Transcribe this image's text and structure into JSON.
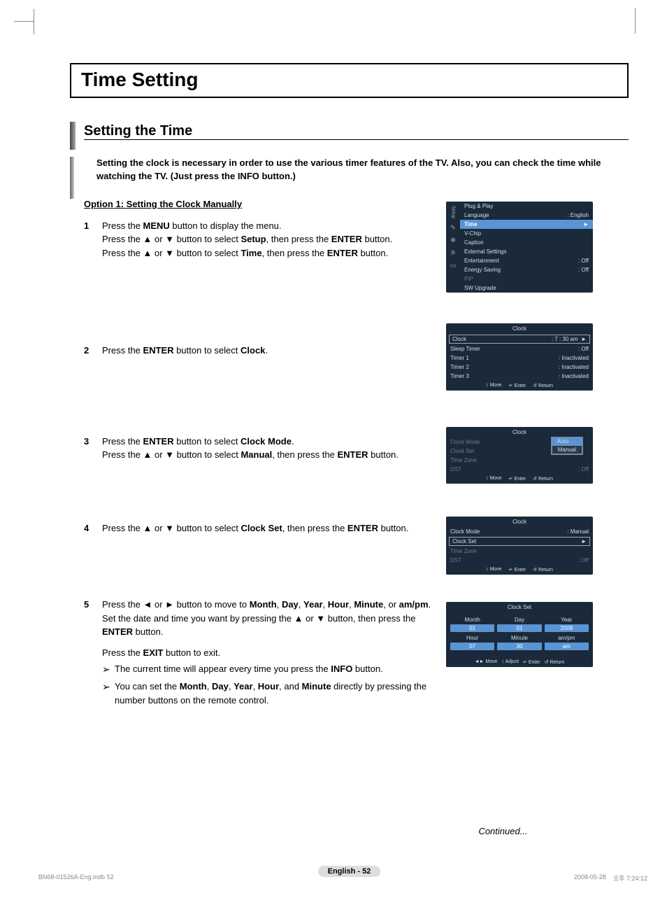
{
  "page": {
    "title": "Time Setting",
    "subheading": "Setting the Time",
    "intro": "Setting the clock is necessary in order to use the various timer features of the TV. Also, you can check the time while watching the TV. (Just press the INFO button.)",
    "option_title": "Option 1: Setting the Clock Manually",
    "continued": "Continued...",
    "page_label": "English - 52",
    "footer_left": "BN68-01526A-Eng.indb   52",
    "footer_date": "2008-05-28",
    "footer_time": "오후 7:24:12"
  },
  "steps": {
    "s1": {
      "num": "1",
      "l1a": "Press the ",
      "l1b": "MENU",
      "l1c": " button to display the menu.",
      "l2a": "Press the ▲ or ▼ button to select ",
      "l2b": "Setup",
      "l2c": ", then press the ",
      "l2d": "ENTER",
      "l2e": " button.",
      "l3a": "Press the ▲ or ▼ button to select ",
      "l3b": "Time",
      "l3c": ", then press the ",
      "l3d": "ENTER",
      "l3e": " button."
    },
    "s2": {
      "num": "2",
      "l1a": "Press the ",
      "l1b": "ENTER",
      "l1c": " button to select ",
      "l1d": "Clock",
      "l1e": "."
    },
    "s3": {
      "num": "3",
      "l1a": "Press the ",
      "l1b": "ENTER",
      "l1c": " button to select ",
      "l1d": "Clock Mode",
      "l1e": ".",
      "l2a": "Press the ▲ or ▼ button to select ",
      "l2b": "Manual",
      "l2c": ", then press the ",
      "l2d": "ENTER",
      "l2e": " button."
    },
    "s4": {
      "num": "4",
      "l1a": "Press the ▲ or ▼ button to select ",
      "l1b": "Clock Set",
      "l1c": ", then press the ",
      "l1d": "ENTER",
      "l1e": " button."
    },
    "s5": {
      "num": "5",
      "l1a": "Press the ◄ or ► button to move to ",
      "l1b": "Month",
      "l1c": ", ",
      "l1d": "Day",
      "l1e": ", ",
      "l1f": "Year",
      "l1g": ", ",
      "l1h": "Hour",
      "l1i": ", ",
      "l1j": "Minute",
      "l1k": ", or ",
      "l1l": "am/pm",
      "l1m": ". Set the date and time you want by pressing the ▲ or ▼ button, then press the ",
      "l1n": "ENTER",
      "l1o": " button.",
      "l2a": "Press the ",
      "l2b": "EXIT",
      "l2c": " button to exit.",
      "n1a": "The current time will appear every time you press the ",
      "n1b": "INFO",
      "n1c": " button.",
      "n2a": "You can set the ",
      "n2b": "Month",
      "n2c": ", ",
      "n2d": "Day",
      "n2e": ", ",
      "n2f": "Year",
      "n2g": ", ",
      "n2h": "Hour",
      "n2i": ", and ",
      "n2j": "Minute",
      "n2k": " directly by pressing the number buttons on the remote control."
    }
  },
  "osd": {
    "setup_tab": "Setup",
    "menu1": {
      "i1": "Plug & Play",
      "i2": "Language",
      "i2v": ": English",
      "i3": "Time",
      "i4": "V-Chip",
      "i5": "Caption",
      "i6": "External Settings",
      "i7": "Entertainment",
      "i7v": ": Off",
      "i8": "Energy Saving",
      "i8v": ": Off",
      "i9": "PIP",
      "i10": "SW Upgrade"
    },
    "foot": {
      "move": "Move",
      "enter": "Enter",
      "ret": "Return",
      "adjust": "Adjust"
    },
    "sym": {
      "updown": "↕",
      "enter": "↵",
      "ret": "↺",
      "lr": "◄►"
    },
    "clock_title": "Clock",
    "menu2": {
      "r1": "Clock",
      "r1v": ":  7 : 30 am",
      "r2": "Sleep Timer",
      "r2v": ": Off",
      "r3": "Timer 1",
      "r3v": ": Inactivated",
      "r4": "Timer 2",
      "r4v": ": Inactivated",
      "r5": "Timer 3",
      "r5v": ": Inactivated"
    },
    "menu3": {
      "r1": "Clock Mode",
      "r2": "Clock Set",
      "r3": "Time Zone",
      "r4": "DST",
      "r4v": ": Off",
      "opt_auto": "Auto",
      "opt_manual": "Manual"
    },
    "menu4": {
      "r1": "Clock Mode",
      "r1v": ": Manual",
      "r2": "Clock Set",
      "r3": "Time Zone",
      "r4": "DST",
      "r4v": ": Off"
    },
    "clockset_title": "Clock Set",
    "cs": {
      "h_month": "Month",
      "h_day": "Day",
      "h_year": "Year",
      "h_hour": "Hour",
      "h_min": "Minute",
      "h_ampm": "am/pm",
      "v_month": "01",
      "v_day": "01",
      "v_year": "2008",
      "v_hour": "07",
      "v_min": "30",
      "v_ampm": "am"
    }
  }
}
